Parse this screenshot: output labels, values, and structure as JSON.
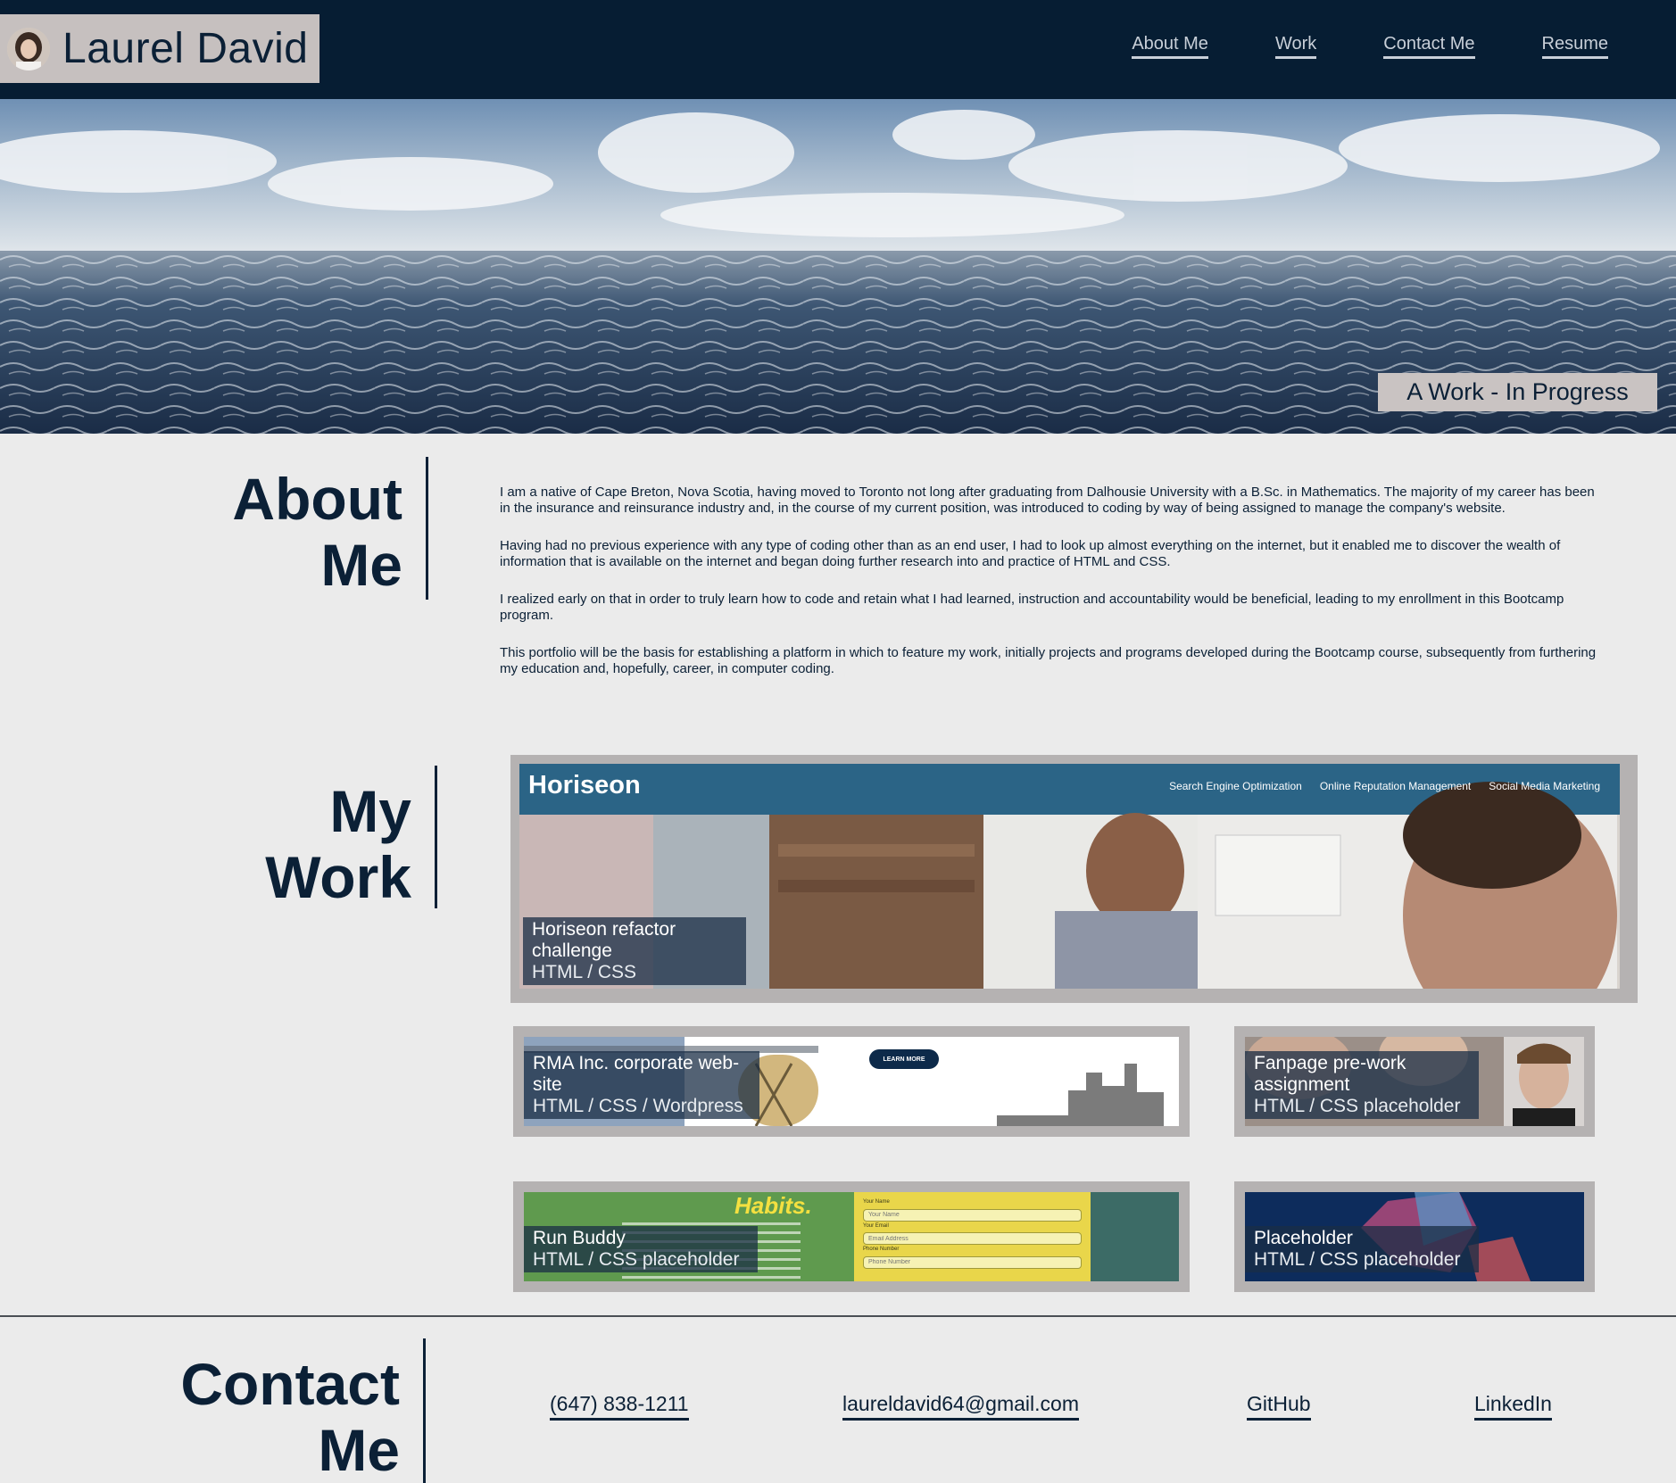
{
  "header": {
    "brand_name": "Laurel David",
    "nav": [
      {
        "label": "About Me"
      },
      {
        "label": "Work"
      },
      {
        "label": "Contact Me"
      },
      {
        "label": "Resume"
      }
    ]
  },
  "hero": {
    "tagline": "A Work - In Progress"
  },
  "about": {
    "heading_line1": "About",
    "heading_line2": "Me",
    "paragraphs": [
      "I am a native of Cape Breton, Nova Scotia, having moved to Toronto not long after graduating from Dalhousie University with a B.Sc. in Mathematics. The majority of my career has been in the insurance and reinsurance industry and, in the course of my current position, was introduced to coding by way of being assigned to manage the company's website.",
      "Having had no previous experience with any type of coding other than as an end user, I had to look up almost everything on the internet, but it enabled me to discover the wealth of information that is available on the internet and began doing further research into and practice of HTML and CSS.",
      "I realized early on that in order to truly learn how to code and retain what I had learned, instruction and accountability would be beneficial, leading to my enrollment in this Bootcamp program.",
      "This portfolio will be the basis for establishing a platform in which to feature my work, initially projects and programs developed during the Bootcamp course, subsequently from furthering my education and, hopefully, career, in computer coding."
    ]
  },
  "work": {
    "heading_line1": "My",
    "heading_line2": "Work",
    "projects": [
      {
        "title": "Horiseon refactor challenge",
        "tech": "HTML / CSS",
        "shot": {
          "logo": "Horiseon",
          "nav": [
            "Search Engine Optimization",
            "Online Reputation Management",
            "Social Media Marketing"
          ]
        }
      },
      {
        "title": "RMA Inc. corporate web-site",
        "tech": "HTML / CSS / Wordpress",
        "shot": {
          "button": "LEARN MORE"
        }
      },
      {
        "title": "Fanpage pre-work assignment",
        "tech": "HTML / CSS placeholder"
      },
      {
        "title": "Run Buddy",
        "tech": "HTML / CSS placeholder",
        "shot": {
          "brand": "Habits.",
          "fields": [
            {
              "label": "Your Name",
              "placeholder": "Your Name"
            },
            {
              "label": "Your Email",
              "placeholder": "Email Address"
            },
            {
              "label": "Phone Number",
              "placeholder": "Phone Number"
            }
          ]
        }
      },
      {
        "title": "Placeholder",
        "tech": "HTML / CSS placeholder"
      }
    ]
  },
  "contact": {
    "heading_line1": "Contact",
    "heading_line2": "Me",
    "links": [
      {
        "label": "(647) 838-1211"
      },
      {
        "label": "laureldavid64@gmail.com"
      },
      {
        "label": "GitHub"
      },
      {
        "label": "LinkedIn"
      }
    ]
  },
  "colors": {
    "header_bg": "#061d33",
    "brand_box": "#c6c0bf",
    "page_bg": "#ebebeb",
    "heading_text": "#0b2036",
    "card_frame": "#b5b2b2",
    "horiseon_nav": "#2b6486"
  }
}
